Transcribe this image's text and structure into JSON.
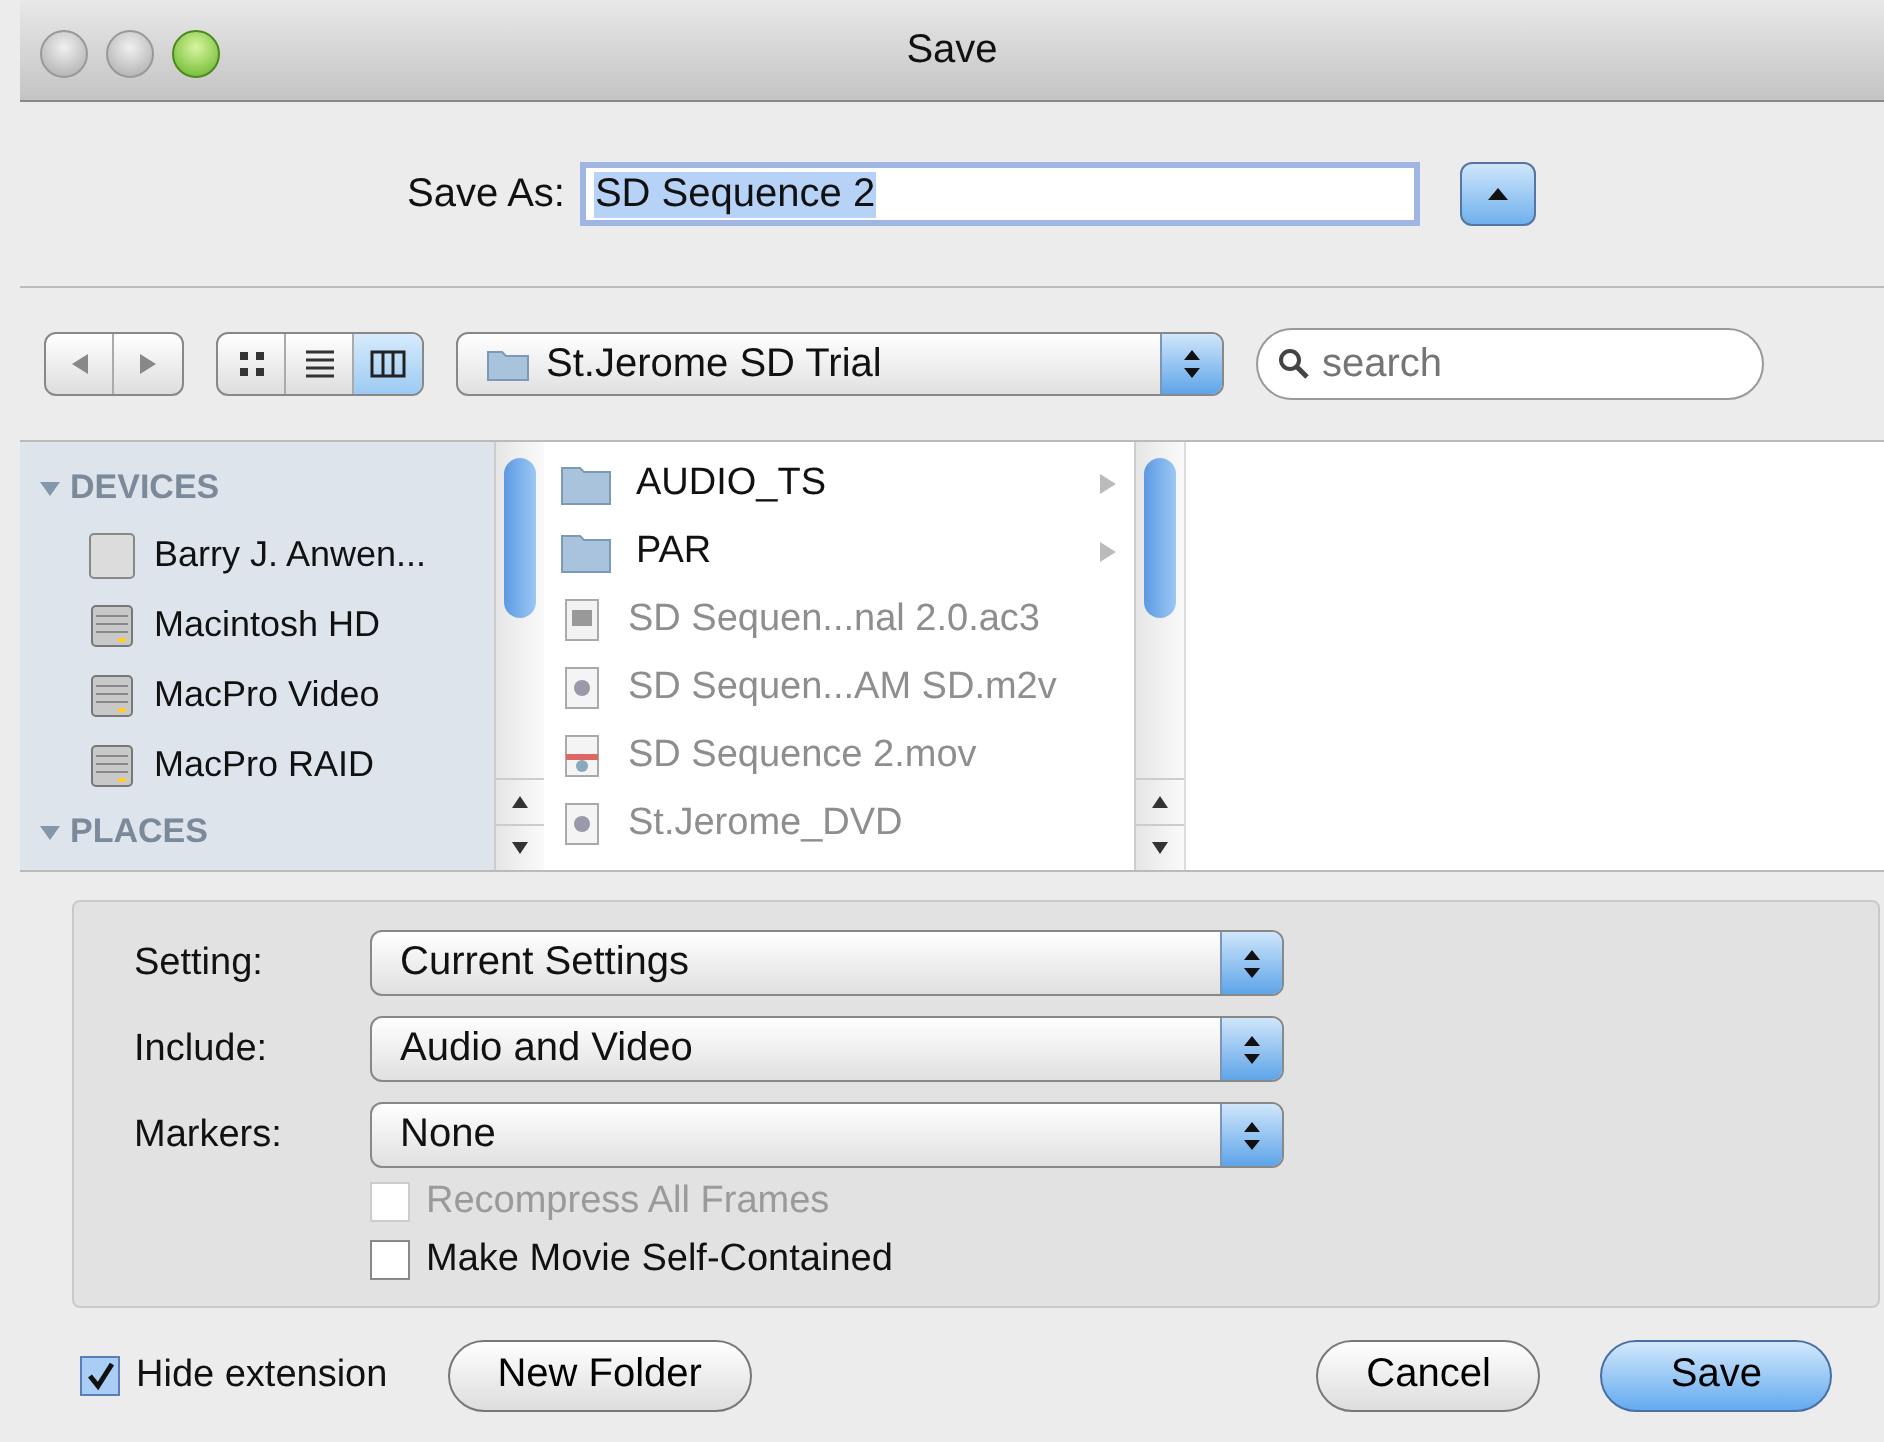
{
  "window": {
    "title": "Save"
  },
  "save_as": {
    "label": "Save As:",
    "value": "SD Sequence 2",
    "expanded": true
  },
  "view_modes": [
    {
      "kind": "icons",
      "selected": false
    },
    {
      "kind": "list",
      "selected": false
    },
    {
      "kind": "columns",
      "selected": true
    }
  ],
  "location": "St.Jerome SD Trial",
  "search": {
    "placeholder": "search"
  },
  "sidebar": {
    "sections": [
      {
        "label": "DEVICES",
        "expanded": true,
        "items": [
          {
            "label": "Barry J. Anwen...",
            "kind": "computer"
          },
          {
            "label": "Macintosh HD",
            "kind": "disk"
          },
          {
            "label": "MacPro Video",
            "kind": "disk"
          },
          {
            "label": "MacPro RAID",
            "kind": "disk"
          }
        ]
      },
      {
        "label": "PLACES",
        "expanded": true
      }
    ]
  },
  "files": [
    {
      "name": "AUDIO_TS",
      "kind": "folder",
      "disabled": false
    },
    {
      "name": "PAR",
      "kind": "folder",
      "disabled": false
    },
    {
      "name": "SD Sequen...nal 2.0.ac3",
      "kind": "audio",
      "disabled": true
    },
    {
      "name": "SD Sequen...AM SD.m2v",
      "kind": "video",
      "disabled": true
    },
    {
      "name": "SD Sequence 2.mov",
      "kind": "movie",
      "disabled": true
    },
    {
      "name": "St.Jerome_DVD",
      "kind": "video",
      "disabled": true
    }
  ],
  "options": {
    "rows": [
      {
        "label": "Setting:",
        "value": "Current Settings"
      },
      {
        "label": "Include:",
        "value": "Audio and Video"
      },
      {
        "label": "Markers:",
        "value": "None"
      }
    ],
    "checks": [
      {
        "label": "Recompress All Frames",
        "checked": false,
        "disabled": true
      },
      {
        "label": "Make Movie Self-Contained",
        "checked": false,
        "disabled": false
      }
    ]
  },
  "hide_extension": {
    "label": "Hide extension",
    "checked": true
  },
  "new_folder": "New Folder",
  "buttons": [
    {
      "label": "Cancel",
      "default": false
    },
    {
      "label": "Save",
      "default": true
    }
  ]
}
